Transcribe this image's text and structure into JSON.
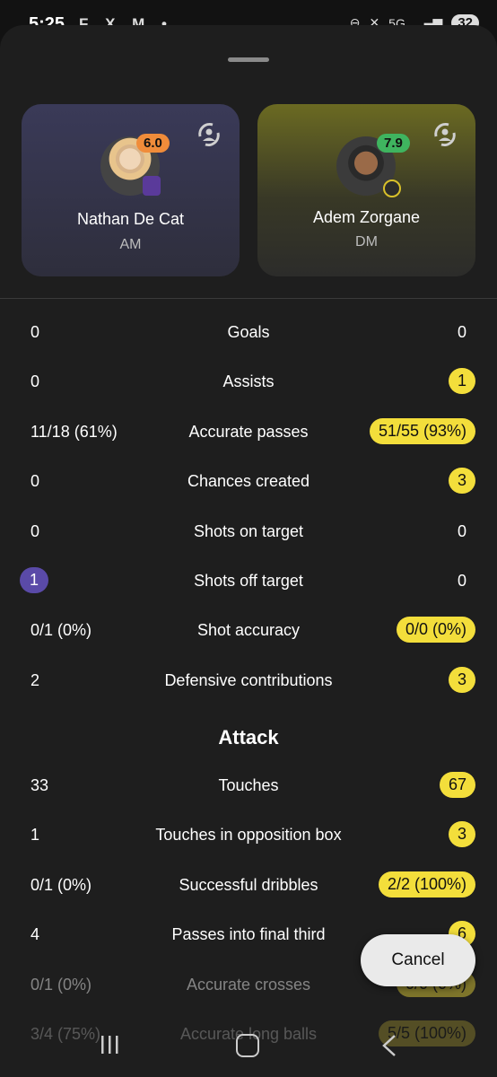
{
  "status_bar": {
    "time": "5:25",
    "app_icons": "F X M •",
    "network": "5G",
    "battery": "32"
  },
  "players": {
    "left": {
      "name": "Nathan De Cat",
      "position": "AM",
      "rating": "6.0",
      "rating_color": "#f08c3a",
      "card_color": "#3a3a58"
    },
    "right": {
      "name": "Adem Zorgane",
      "position": "DM",
      "rating": "7.9",
      "rating_color": "#3fb45f",
      "card_color": "#6b6a22"
    }
  },
  "highlight_colors": {
    "left": "#5a4aa8",
    "right": "#f3de3b"
  },
  "stats": [
    {
      "label": "Goals",
      "left": "0",
      "right": "0",
      "highlight": "none"
    },
    {
      "label": "Assists",
      "left": "0",
      "right": "1",
      "highlight": "right"
    },
    {
      "label": "Accurate passes",
      "left": "11/18 (61%)",
      "right": "51/55 (93%)",
      "highlight": "right"
    },
    {
      "label": "Chances created",
      "left": "0",
      "right": "3",
      "highlight": "right"
    },
    {
      "label": "Shots on target",
      "left": "0",
      "right": "0",
      "highlight": "none"
    },
    {
      "label": "Shots off target",
      "left": "1",
      "right": "0",
      "highlight": "left"
    },
    {
      "label": "Shot accuracy",
      "left": "0/1 (0%)",
      "right": "0/0 (0%)",
      "highlight": "right"
    },
    {
      "label": "Defensive contributions",
      "left": "2",
      "right": "3",
      "highlight": "right"
    }
  ],
  "section_attack": "Attack",
  "attack_stats": [
    {
      "label": "Touches",
      "left": "33",
      "right": "67",
      "highlight": "right"
    },
    {
      "label": "Touches in opposition box",
      "left": "1",
      "right": "3",
      "highlight": "right"
    },
    {
      "label": "Successful dribbles",
      "left": "0/1 (0%)",
      "right": "2/2 (100%)",
      "highlight": "right"
    },
    {
      "label": "Passes into final third",
      "left": "4",
      "right": "6",
      "highlight": "right"
    },
    {
      "label": "Accurate crosses",
      "left": "0/1 (0%)",
      "right": "0/0 (0%)",
      "highlight": "right"
    },
    {
      "label": "Accurate long balls",
      "left": "3/4 (75%)",
      "right": "5/5 (100%)",
      "highlight": "right"
    }
  ],
  "cancel_label": "Cancel"
}
